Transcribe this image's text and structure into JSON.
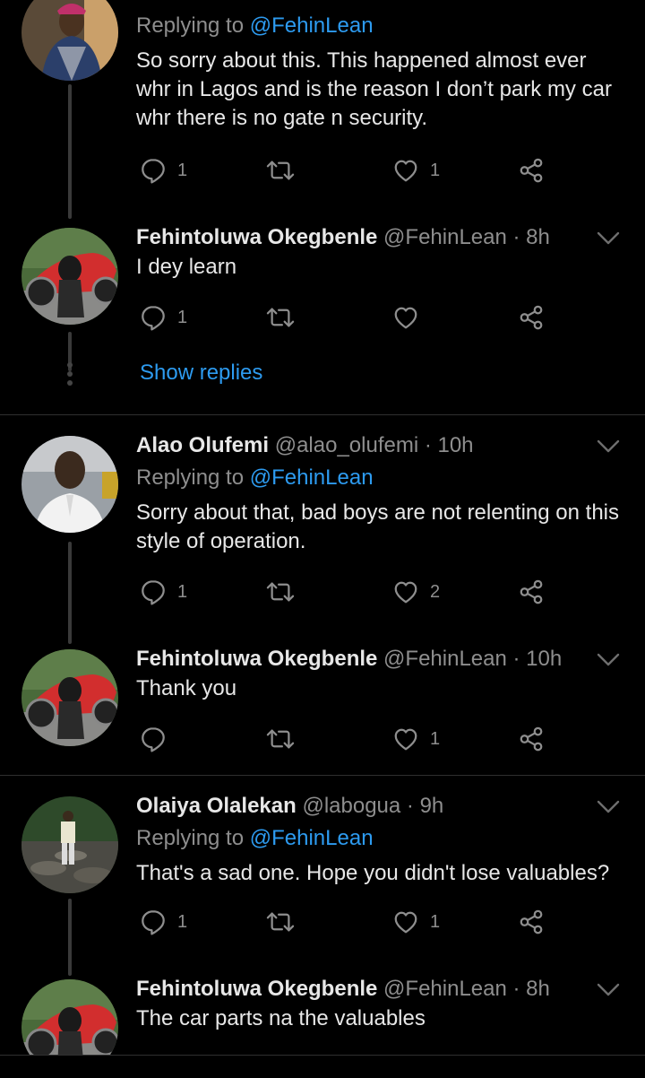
{
  "colors": {
    "background": "#000000",
    "link": "#2d9bf0",
    "muted": "#8e8e8e",
    "text": "#e7e7e7"
  },
  "tweets": [
    {
      "name": "",
      "handle": "",
      "time": "",
      "replying_label": "Replying to",
      "replying_to": "@FehinLean",
      "text": "So sorry about this. This happened almost ever whr in Lagos and is the reason I don’t park my car whr there is no gate n security.",
      "replies": "1",
      "retweets": "",
      "likes": "1"
    },
    {
      "name": "Fehintoluwa Okegbenle",
      "handle": "@FehinLean",
      "time": "· 8h",
      "text": "I dey learn",
      "replies": "1",
      "retweets": "",
      "likes": ""
    },
    {
      "name": "Alao Olufemi",
      "handle": "@alao_olufemi",
      "time": "· 10h",
      "replying_label": "Replying to",
      "replying_to": "@FehinLean",
      "text": "Sorry about that, bad boys are not relenting on this style of operation.",
      "replies": "1",
      "retweets": "",
      "likes": "2"
    },
    {
      "name": "Fehintoluwa Okegbenle",
      "handle": "@FehinLean",
      "time": "· 10h",
      "text": "Thank you",
      "replies": "",
      "retweets": "",
      "likes": "1"
    },
    {
      "name": "Olaiya Olalekan",
      "handle": "@labogua",
      "time": "· 9h",
      "replying_label": "Replying to",
      "replying_to": "@FehinLean",
      "text": "That's a sad one. Hope you didn't lose valuables?",
      "replies": "1",
      "retweets": "",
      "likes": "1"
    },
    {
      "name": "Fehintoluwa Okegbenle",
      "handle": "@FehinLean",
      "time": "· 8h",
      "text": "The car parts na the valuables"
    }
  ],
  "show_replies": "Show replies"
}
